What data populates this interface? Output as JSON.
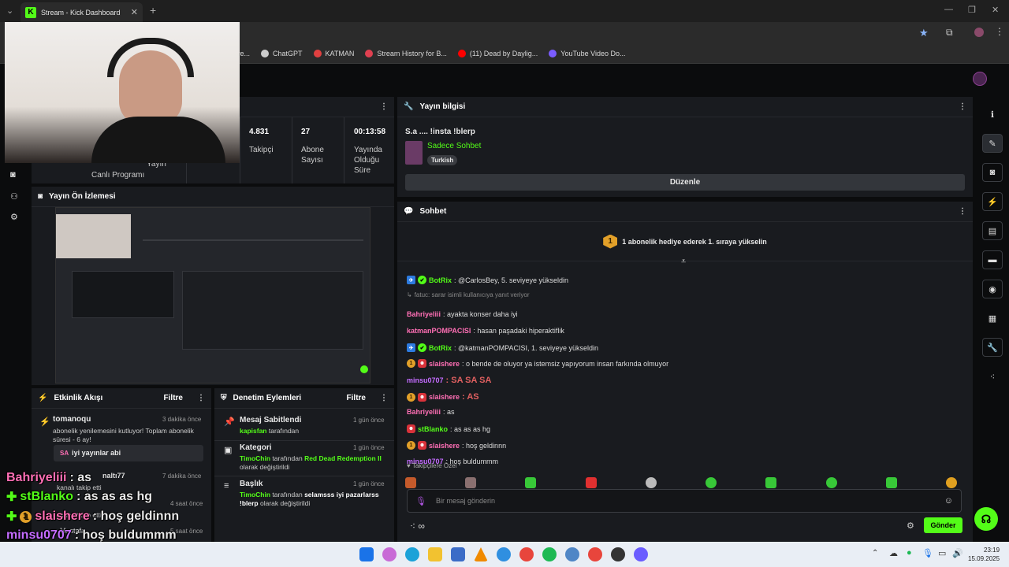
{
  "browser": {
    "tab_title": "Stream - Kick Dashboard",
    "new_tab": "+",
    "bookmarks": [
      "ve...",
      "ChatGPT",
      "KATMAN",
      "Stream History for B...",
      "(11) Dead by Daylig...",
      "YouTube Video Do..."
    ]
  },
  "stats": [
    {
      "value": "4.831",
      "label": "Takipçi"
    },
    {
      "value": "27",
      "label": "Abone Sayısı"
    },
    {
      "value": "00:13:58",
      "label": "Yayında Olduğu Süre"
    }
  ],
  "stats_partial": {
    "left": "Canlı Programı",
    "mid": "Yayın"
  },
  "preview": {
    "title": "Yayın Ön İzlemesi"
  },
  "stream_info": {
    "title": "Yayın bilgisi",
    "stream_title": "S.a .... !insta !blerp",
    "category": "Sadece Sohbet",
    "tag": "Turkish",
    "edit_label": "Düzenle"
  },
  "chat": {
    "title": "Sohbet",
    "promo": "1 abonelik hediye ederek 1. sıraya yükselin",
    "reply_hint": "fatuc: sarar isimli kullanıcıya yanıt veriyor",
    "messages": [
      {
        "user": "BotRix",
        "text": ": @CarlosBey, 5. seviyeye yükseldin",
        "color": "#53fc18",
        "badges": [
          "bot",
          "kick"
        ]
      },
      {
        "user": "Bahriyeliii",
        "text": ": ayakta konser daha iyi",
        "color": "#ff6fb5",
        "badges": []
      },
      {
        "user": "katmanPOMPACISI",
        "text": ": hasan paşadaki hiperaktiflik",
        "color": "#ff6fb5",
        "badges": []
      },
      {
        "user": "BotRix",
        "text": ": @katmanPOMPACISI, 1. seviyeye yükseldin",
        "color": "#53fc18",
        "badges": [
          "bot",
          "kick"
        ]
      },
      {
        "user": "slaishere",
        "text": ": o bende de oluyor ya istemsiz yapıyorum insan farkında olmuyor",
        "color": "#ff6fb5",
        "badges": [
          "gold",
          "red"
        ]
      },
      {
        "user": "minsu0707",
        "text": ": SA SA SA",
        "color": "#c46cff",
        "badges": []
      },
      {
        "user": "slaishere",
        "text": ": AS",
        "color": "#ff6fb5",
        "badges": [
          "gold",
          "red"
        ]
      },
      {
        "user": "Bahriyeliii",
        "text": ": as",
        "color": "#ff6fb5",
        "badges": []
      },
      {
        "user": "stBlanko",
        "text": ": as as as hg",
        "color": "#53fc18",
        "badges": [
          "red"
        ]
      },
      {
        "user": "slaishere",
        "text": ": hoş geldinnn",
        "color": "#ff6fb5",
        "badges": [
          "gold",
          "red"
        ]
      },
      {
        "user": "minsu0707",
        "text": ": hoş buldummm",
        "color": "#c46cff",
        "badges": []
      }
    ],
    "followers_only": "Takipçilere Özel",
    "input_placeholder": "Bir mesaj gönderin",
    "send_label": "Gönder",
    "infinity": "∞"
  },
  "activity": {
    "title": "Etkinlik Akışı",
    "filter": "Filtre",
    "items": [
      {
        "user": "tomanoqu",
        "time": "3 dakika önce",
        "text": "abonelik yenilemesini kutluyor! Toplam abonelik süresi - 6 ay!",
        "quote": "iyi yayınlar abi"
      },
      {
        "user": "naltı77",
        "time": "7 dakika önce",
        "text": "kanalı takip etti"
      },
      {
        "user": "",
        "time": "4 saat önce",
        "text": "kanalı takip etti"
      },
      {
        "user": "Mustafa",
        "time": "5 saat önce",
        "text": ""
      }
    ]
  },
  "moderation": {
    "title": "Denetim Eylemleri",
    "filter": "Filtre",
    "items": [
      {
        "title": "Mesaj Sabitlendi",
        "time": "1 gün önce",
        "actor": "kapisfan",
        "rest": " tarafından",
        "extra": ""
      },
      {
        "title": "Kategori",
        "time": "1 gün önce",
        "actor": "TimoChin",
        "rest": " tarafından ",
        "extra": "Red Dead Redemption II",
        "tail": " olarak değiştirildi"
      },
      {
        "title": "Başlık",
        "time": "1 gün önce",
        "actor": "TimoChin",
        "rest": " tarafından ",
        "extra": "selamsss iyi pazarlarss !blerp",
        "tail": " olarak değiştirildi"
      }
    ]
  },
  "overlay": [
    {
      "user": "Bahriyeliii",
      "text": ": as",
      "color": "#ff6fb5"
    },
    {
      "user": "stBlanko",
      "text": ": as as as hg",
      "color": "#53fc18"
    },
    {
      "user": "slaishere",
      "text": ": hoş geldinnn",
      "color": "#ff6fb5"
    },
    {
      "user": "minsu0707",
      "text": ": hoş buldummm",
      "color": "#c46cff"
    }
  ],
  "taskbar": {
    "time": "23:19",
    "date": "15.09.2025"
  },
  "colors": {
    "accent": "#53fc18",
    "panel": "#191b1f",
    "background": "#0b0c0d"
  }
}
